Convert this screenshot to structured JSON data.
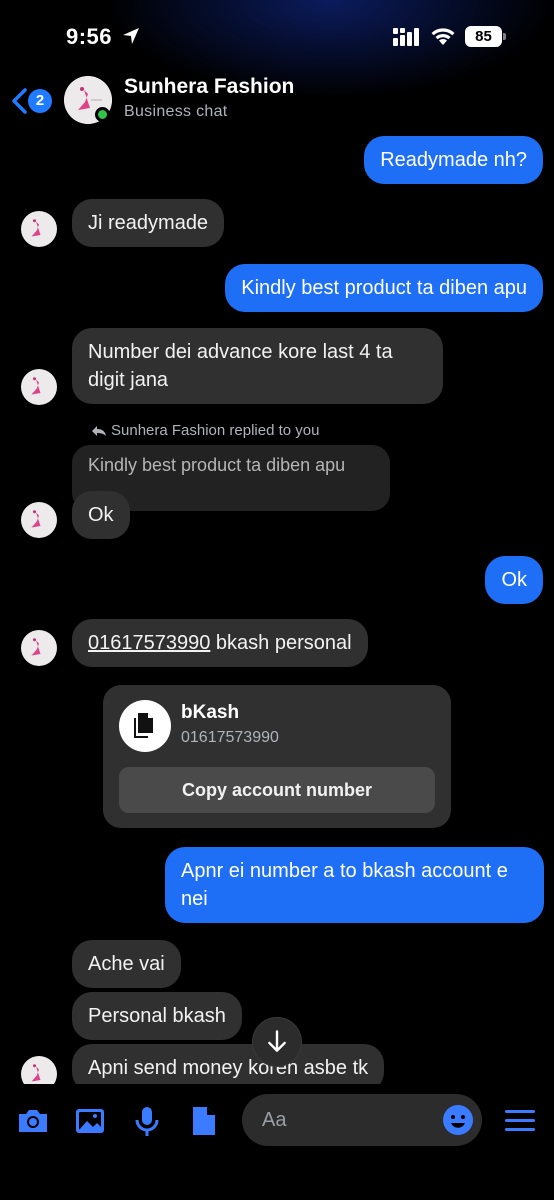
{
  "status_bar": {
    "time": "9:56",
    "battery": "85"
  },
  "header": {
    "back_count": "2",
    "title": "Sunhera Fashion",
    "subtitle": "Business chat"
  },
  "messages": [
    {
      "from": "me",
      "text": "Readymade nh?"
    },
    {
      "from": "them",
      "text": "Ji readymade"
    },
    {
      "from": "me",
      "text": "Kindly best product ta diben apu"
    },
    {
      "from": "them",
      "text": "Number dei advance kore last 4 ta digit jana"
    },
    {
      "from": "them",
      "reply_note": "Sunhera Fashion replied to you",
      "quoted": "Kindly best product ta diben apu",
      "text": "Ok"
    },
    {
      "from": "me",
      "text": "Ok"
    },
    {
      "from": "them",
      "number": "01617573990",
      "text": " bkash personal"
    },
    {
      "from": "me",
      "text": "Apnr ei number a to bkash account e nei"
    },
    {
      "from": "them",
      "text": "Ache vai"
    },
    {
      "from": "them",
      "text": "Personal bkash"
    },
    {
      "from": "them",
      "text": "Apni send money koren asbe tk"
    }
  ],
  "account_card": {
    "title": "bKash",
    "number": "01617573990",
    "button": "Copy account number"
  },
  "composer": {
    "placeholder": "Aa"
  },
  "colors": {
    "outgoing": "#1e6ff6",
    "incoming": "#303030",
    "accent": "#3b7bff"
  }
}
